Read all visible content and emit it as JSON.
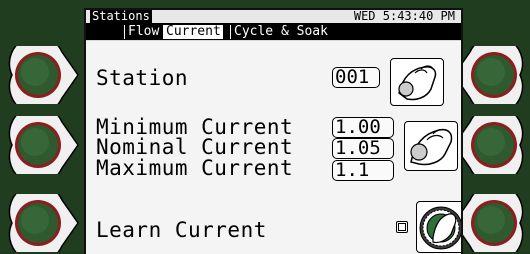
{
  "header": {
    "screen_title": "Stations",
    "datetime": "WED 5:43:40 PM"
  },
  "tabs": [
    {
      "label": "Flow",
      "active": false
    },
    {
      "label": "Current",
      "active": true
    },
    {
      "label": "Cycle & Soak",
      "active": false
    }
  ],
  "fields": {
    "station": {
      "label": "Station",
      "value": "001"
    },
    "minimum_current": {
      "label": "Minimum Current",
      "value": "1.00"
    },
    "nominal_current": {
      "label": "Nominal Current",
      "value": "1.05"
    },
    "maximum_current": {
      "label": "Maximum Current",
      "value": "1.1"
    },
    "learn_current": {
      "label": "Learn Current",
      "checked": false
    }
  },
  "colors": {
    "bezel": "#203d20",
    "button_red": "#c0392b",
    "button_green": "#2e5a2e"
  }
}
